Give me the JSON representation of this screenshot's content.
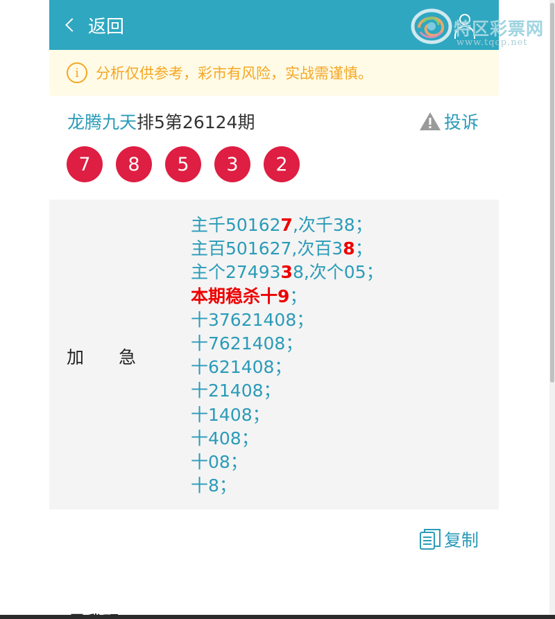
{
  "header": {
    "back_label": "返回",
    "bg_color": "#2fa7c0"
  },
  "logo": {
    "title": "特区彩票网",
    "url_text": "www.tqcp.net"
  },
  "notice": {
    "text": "分析仅供参考，彩市有风险，实战需谨慎。",
    "icon": "info-icon"
  },
  "post": {
    "author": "龙腾九天",
    "title_rest": "排5第26124期",
    "complain_label": "投诉",
    "balls": [
      "7",
      "8",
      "5",
      "3",
      "2"
    ],
    "ball_color": "#de1e42"
  },
  "panel": {
    "label": "加　　急",
    "lines": [
      {
        "pre": "主千50162",
        "hl": "7",
        "post": ",次千38；"
      },
      {
        "pre": "主百501627,次百3",
        "hl": "8",
        "post": "；"
      },
      {
        "pre": "主个27493",
        "hl": "3",
        "post": "",
        "post2": "8,次个05；"
      },
      {
        "lead": "本期稳杀十9",
        "post": "；"
      },
      {
        "pre": "十37621408；"
      },
      {
        "pre": "十7621408；"
      },
      {
        "pre": "十621408；"
      },
      {
        "pre": "十21408；"
      },
      {
        "pre": "十1408；"
      },
      {
        "pre": "十408；"
      },
      {
        "pre": "十08；"
      },
      {
        "pre": "十8；"
      }
    ]
  },
  "copy": {
    "label": "复制"
  },
  "bottom": {
    "text": "尽我现"
  }
}
